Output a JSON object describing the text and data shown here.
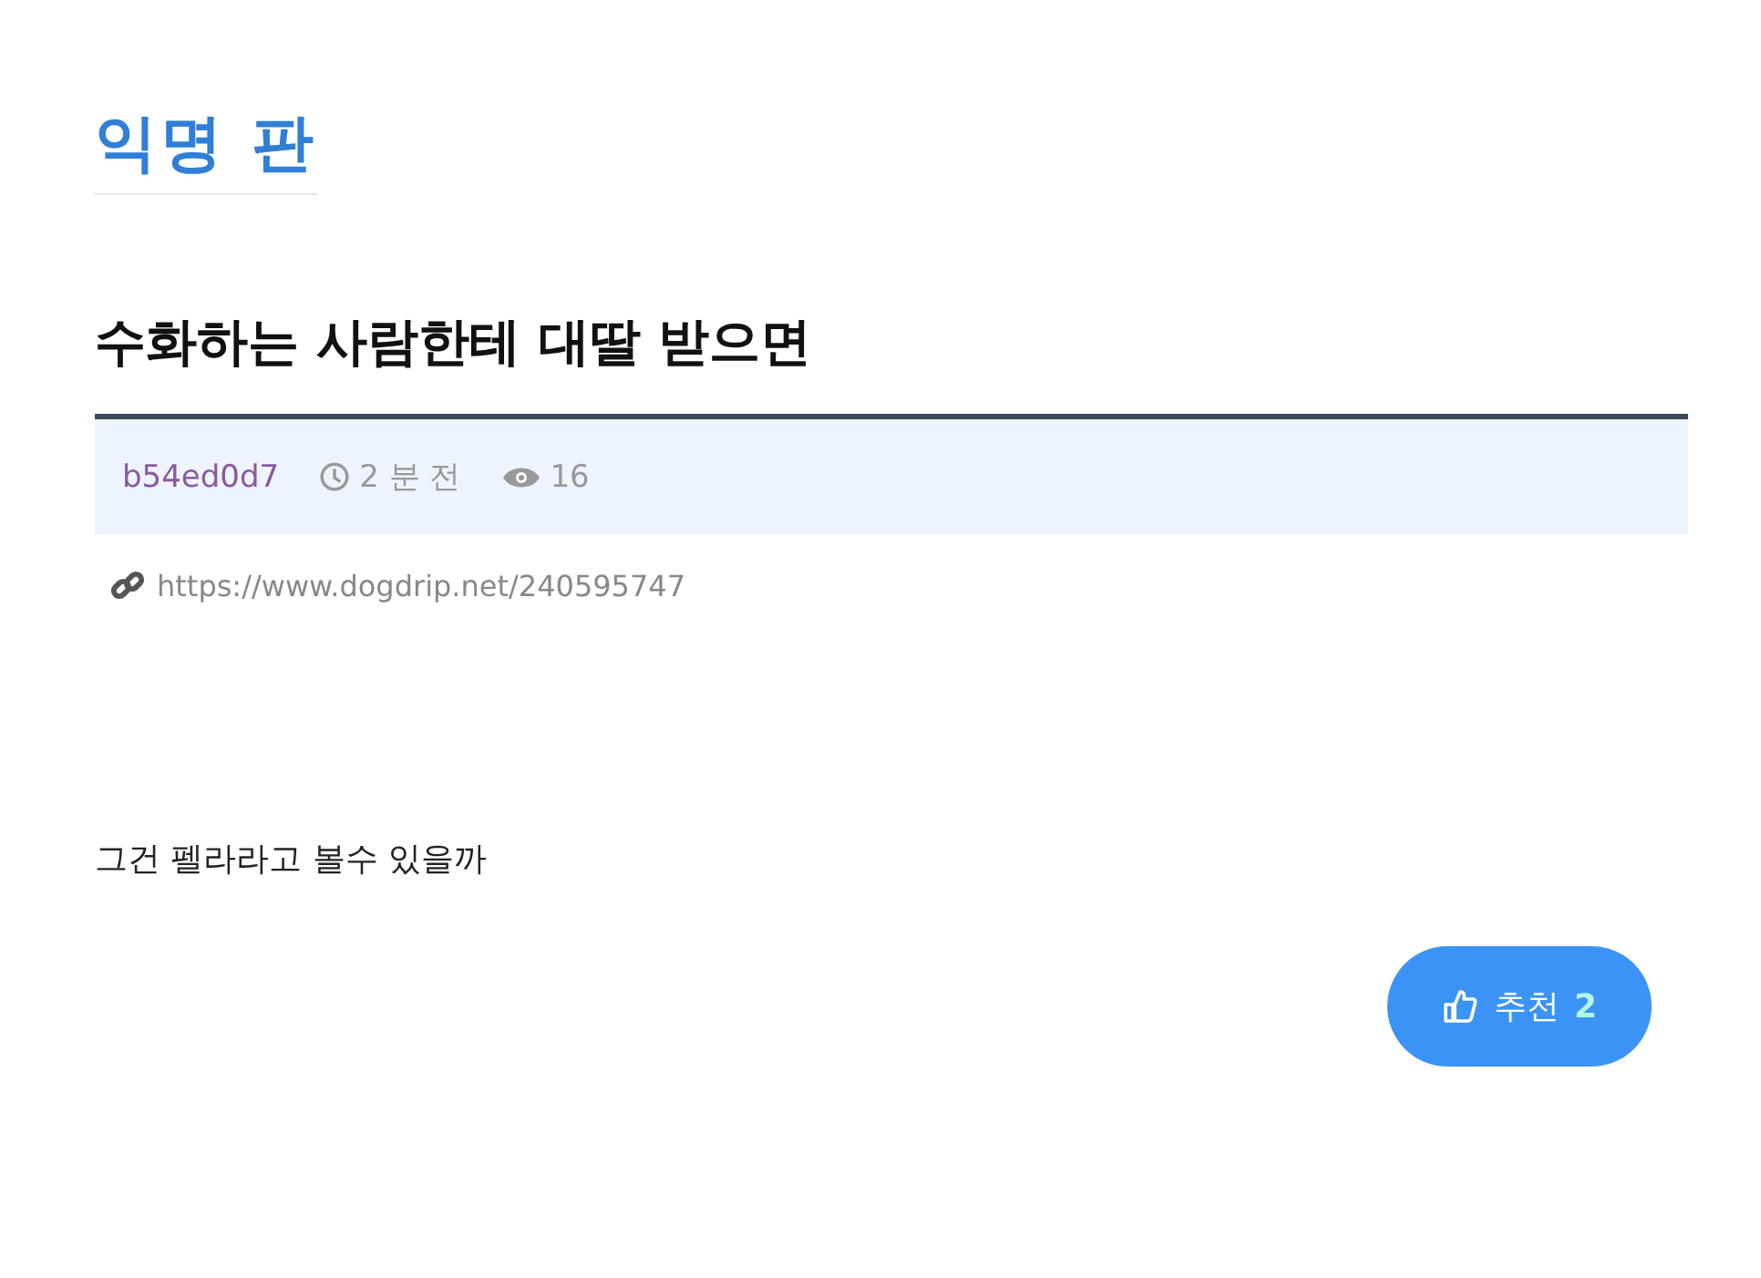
{
  "board": {
    "title": "익명 판"
  },
  "post": {
    "title": "수화하는 사람한테 대딸 받으면",
    "author": "b54ed0d7",
    "time": "2 분 전",
    "views": "16",
    "link": "https://www.dogdrip.net/240595747",
    "body": "그건 펠라라고 볼수 있을까"
  },
  "vote": {
    "label": "추천",
    "count": "2"
  }
}
